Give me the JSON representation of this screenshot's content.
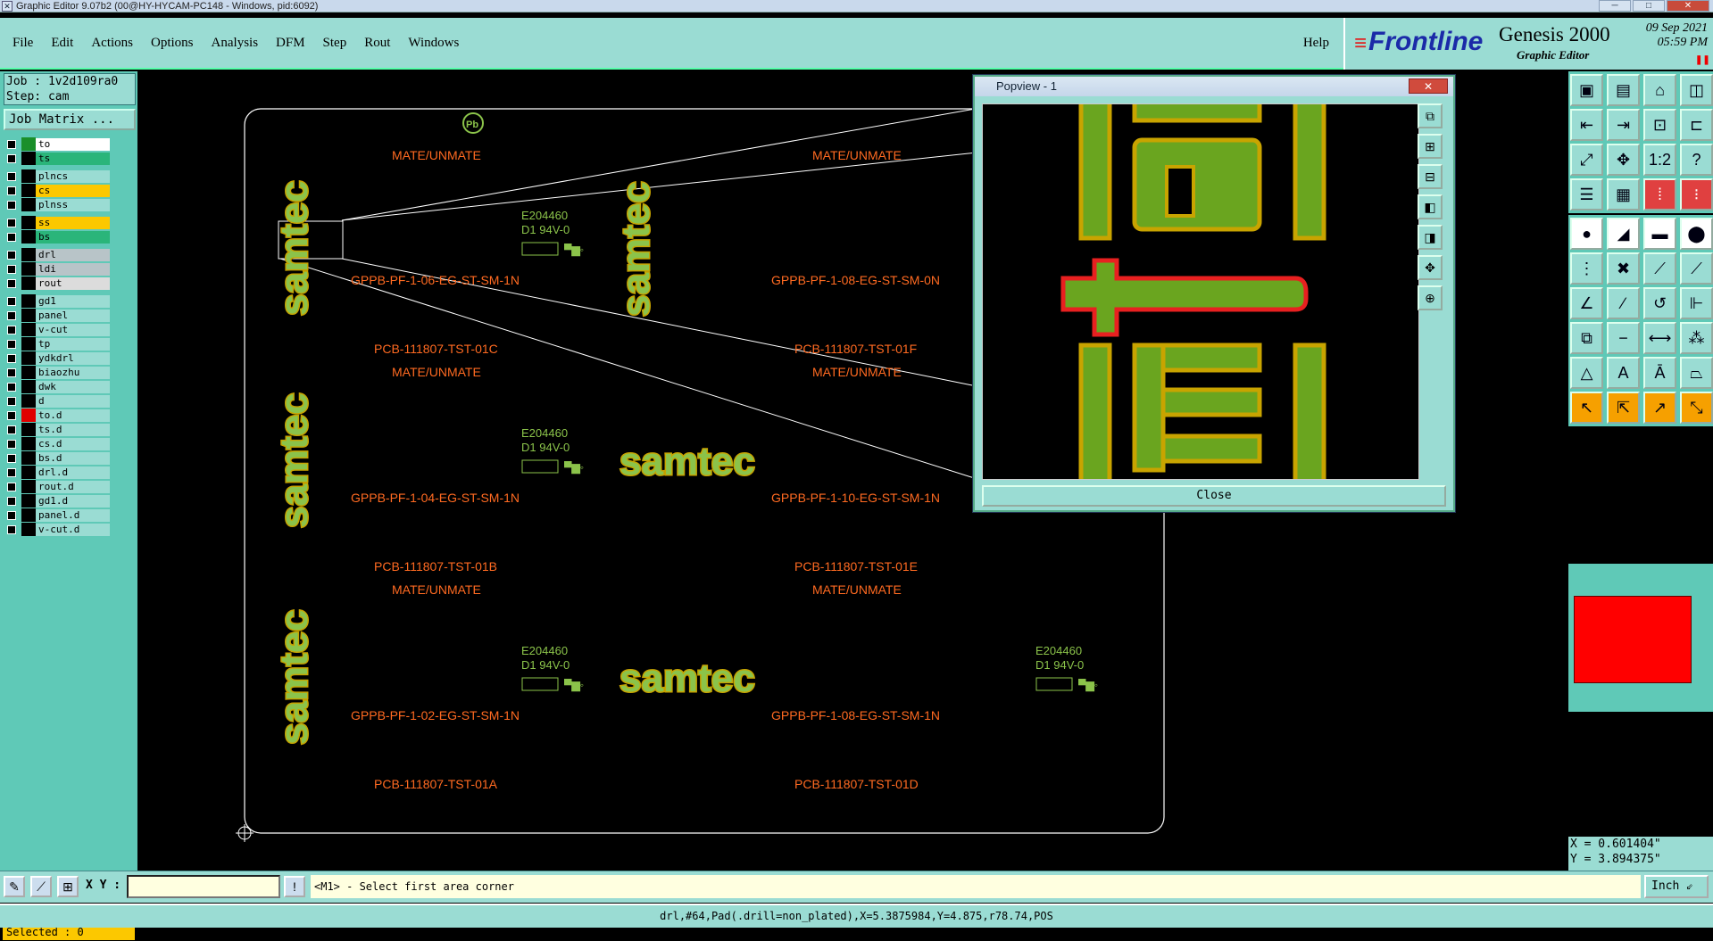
{
  "window": {
    "title": "Graphic Editor 9.07b2 (00@HY-HYCAM-PC148 - Windows, pid:6092)"
  },
  "menu": [
    "File",
    "Edit",
    "Actions",
    "Options",
    "Analysis",
    "DFM",
    "Step",
    "Rout",
    "Windows"
  ],
  "help_label": "Help",
  "brand": {
    "logo": "Frontline",
    "product": "Genesis 2000",
    "subtitle": "Graphic Editor",
    "date_line1": "09 Sep 2021",
    "date_line2": "05:59 PM"
  },
  "job": {
    "job_line": "Job : 1v2d109ra0",
    "step_line": "Step: cam",
    "matrix_button": "Job Matrix ..."
  },
  "layers": [
    {
      "name": "to",
      "bg": "#ffffff",
      "swatch": "#1a8f2a",
      "group": 1
    },
    {
      "name": "ts",
      "bg": "#2ab57a",
      "swatch": "#000000",
      "group": 1
    },
    {
      "name": "plncs",
      "bg": "#9adcd3",
      "swatch": "#000000",
      "group": 2
    },
    {
      "name": "cs",
      "bg": "#fcc800",
      "swatch": "#000000",
      "group": 2
    },
    {
      "name": "plnss",
      "bg": "#9adcd3",
      "swatch": "#000000",
      "group": 2
    },
    {
      "name": "ss",
      "bg": "#fcc800",
      "swatch": "#000000",
      "group": 3
    },
    {
      "name": "bs",
      "bg": "#2ab57a",
      "swatch": "#000000",
      "group": 3
    },
    {
      "name": "drl",
      "bg": "#b8c4c8",
      "swatch": "#000000",
      "group": 4
    },
    {
      "name": "ldi",
      "bg": "#b8c4c8",
      "swatch": "#000000",
      "group": 4
    },
    {
      "name": "rout",
      "bg": "#dcdcdc",
      "swatch": "#000000",
      "group": 4
    },
    {
      "name": "gd1",
      "bg": "#9adcd3",
      "swatch": "#000000",
      "group": 5
    },
    {
      "name": "panel",
      "bg": "#9adcd3",
      "swatch": "#000000",
      "group": 5
    },
    {
      "name": "v-cut",
      "bg": "#9adcd3",
      "swatch": "#000000",
      "group": 5
    },
    {
      "name": "tp",
      "bg": "#9adcd3",
      "swatch": "#000000",
      "group": 5
    },
    {
      "name": "ydkdrl",
      "bg": "#9adcd3",
      "swatch": "#000000",
      "group": 5
    },
    {
      "name": "biaozhu",
      "bg": "#9adcd3",
      "swatch": "#000000",
      "group": 5
    },
    {
      "name": "dwk",
      "bg": "#9adcd3",
      "swatch": "#000000",
      "group": 5
    },
    {
      "name": "d",
      "bg": "#9adcd3",
      "swatch": "#000000",
      "group": 5
    },
    {
      "name": "to.d",
      "bg": "#9adcd3",
      "swatch": "#e00000",
      "group": 5
    },
    {
      "name": "ts.d",
      "bg": "#9adcd3",
      "swatch": "#000000",
      "group": 5
    },
    {
      "name": "cs.d",
      "bg": "#9adcd3",
      "swatch": "#000000",
      "group": 5
    },
    {
      "name": "bs.d",
      "bg": "#9adcd3",
      "swatch": "#000000",
      "group": 5
    },
    {
      "name": "drl.d",
      "bg": "#9adcd3",
      "swatch": "#000000",
      "group": 5
    },
    {
      "name": "rout.d",
      "bg": "#9adcd3",
      "swatch": "#000000",
      "group": 5
    },
    {
      "name": "gd1.d",
      "bg": "#9adcd3",
      "swatch": "#000000",
      "group": 5
    },
    {
      "name": "panel.d",
      "bg": "#9adcd3",
      "swatch": "#000000",
      "group": 5
    },
    {
      "name": "v-cut.d",
      "bg": "#9adcd3",
      "swatch": "#000000",
      "group": 5
    }
  ],
  "selected_text": "Selected : 0",
  "board": {
    "labels": [
      {
        "t": "MATE/UNMATE"
      },
      {
        "t": "MATE/UNMATE"
      },
      {
        "t": "GPPB-PF-1-06-EG-ST-SM-1N"
      },
      {
        "t": "GPPB-PF-1-08-EG-ST-SM-0N"
      },
      {
        "t": "PCB-111807-TST-01C"
      },
      {
        "t": "PCB-111807-TST-01F"
      },
      {
        "t": "MATE/UNMATE"
      },
      {
        "t": "MATE/UNMATE"
      },
      {
        "t": "GPPB-PF-1-04-EG-ST-SM-1N"
      },
      {
        "t": "GPPB-PF-1-10-EG-ST-SM-1N"
      },
      {
        "t": "PCB-111807-TST-01B"
      },
      {
        "t": "PCB-111807-TST-01E"
      },
      {
        "t": "MATE/UNMATE"
      },
      {
        "t": "MATE/UNMATE"
      },
      {
        "t": "GPPB-PF-1-02-EG-ST-SM-1N"
      },
      {
        "t": "GPPB-PF-1-08-EG-ST-SM-1N"
      },
      {
        "t": "PCB-111807-TST-01A"
      },
      {
        "t": "PCB-111807-TST-01D"
      }
    ],
    "ul_lines": [
      {
        "l1": "E204460",
        "l2": "D1  94V-0"
      },
      {
        "l1": "E204460",
        "l2": "D1  94V-0"
      },
      {
        "l1": "E204460",
        "l2": "D1  94V-0"
      },
      {
        "l1": "E204460",
        "l2": "D1  94V-0"
      }
    ],
    "logo_text": "samtec",
    "colors": {
      "label": "#ff6a21",
      "silkscreen": "#8bc34a",
      "copper": "#c8a400",
      "outline": "#ffffff"
    }
  },
  "popview": {
    "title": "Popview - 1",
    "close_label": "Close"
  },
  "coords": {
    "x": "X = 0.601404\"",
    "y": "Y = 3.894375\""
  },
  "bottom": {
    "xy_label": "X Y :",
    "xy_value": "",
    "prompt": "<M1> - Select first area corner",
    "unit": "Inch"
  },
  "status": "drl,#64,Pad(.drill=non_plated),X=5.3875984,Y=4.875,r78.74,POS"
}
